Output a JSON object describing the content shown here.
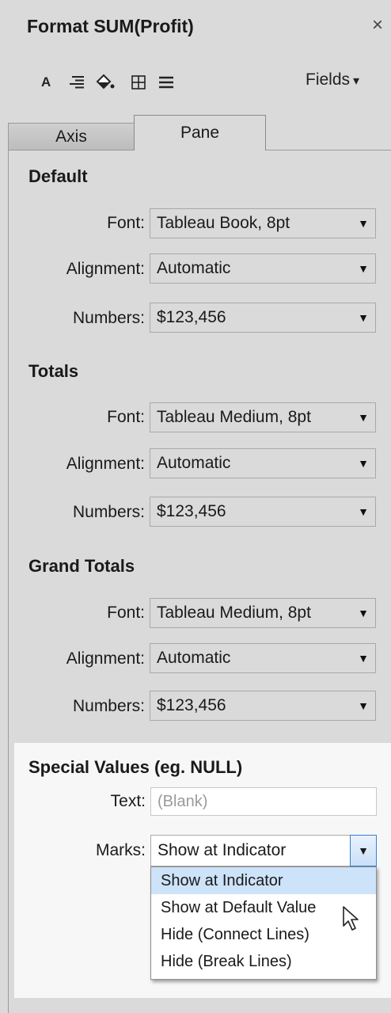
{
  "window": {
    "title": "Format SUM(Profit)",
    "close_glyph": "×"
  },
  "toolbar": {
    "icons": [
      "font-icon",
      "alignment-icon",
      "shading-icon",
      "borders-icon",
      "lines-icon"
    ],
    "font_glyph": "A",
    "fields_label": "Fields",
    "fields_caret": "▾"
  },
  "tabs": [
    {
      "label": "Axis",
      "active": false
    },
    {
      "label": "Pane",
      "active": true
    }
  ],
  "sections": {
    "default": {
      "heading": "Default",
      "font_label": "Font:",
      "font_value": "Tableau Book, 8pt",
      "alignment_label": "Alignment:",
      "alignment_value": "Automatic",
      "numbers_label": "Numbers:",
      "numbers_value": "$123,456"
    },
    "totals": {
      "heading": "Totals",
      "font_label": "Font:",
      "font_value": "Tableau Medium, 8pt",
      "alignment_label": "Alignment:",
      "alignment_value": "Automatic",
      "numbers_label": "Numbers:",
      "numbers_value": "$123,456"
    },
    "grand_totals": {
      "heading": "Grand Totals",
      "font_label": "Font:",
      "font_value": "Tableau Medium, 8pt",
      "alignment_label": "Alignment:",
      "alignment_value": "Automatic",
      "numbers_label": "Numbers:",
      "numbers_value": "$123,456"
    },
    "special": {
      "heading": "Special Values (eg. NULL)",
      "text_label": "Text:",
      "text_placeholder": "(Blank)",
      "marks_label": "Marks:",
      "marks_value": "Show at Indicator",
      "marks_options": [
        "Show at Indicator",
        "Show at Default Value",
        "Hide (Connect Lines)",
        "Hide (Break Lines)"
      ]
    }
  },
  "dropdown_arrow": "▼",
  "colors": {
    "panel_bg": "#dadada",
    "special_bg": "#f7f7f7",
    "selected_item": "#cde3f9",
    "focus_border": "#3b7ed1"
  }
}
